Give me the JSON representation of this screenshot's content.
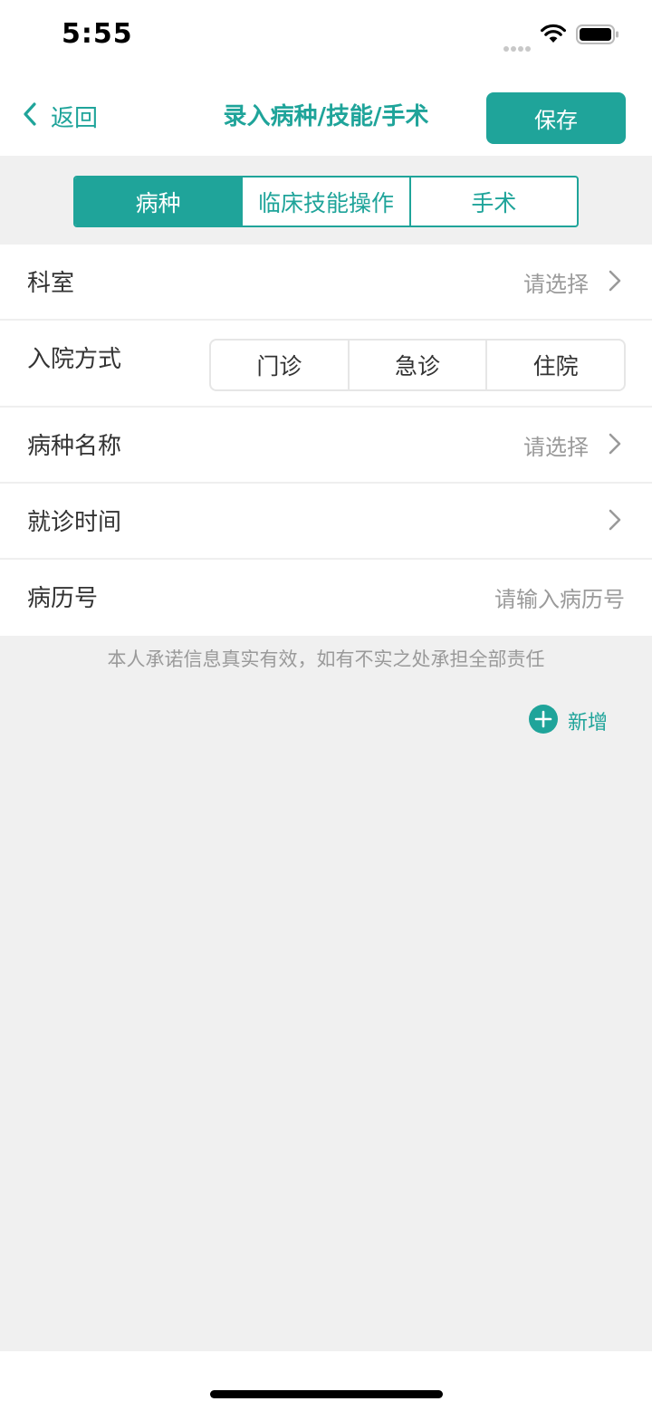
{
  "status": {
    "time": "5:55"
  },
  "nav": {
    "back_label": "返回",
    "title": "录入病种/技能/手术",
    "save_label": "保存"
  },
  "tabs": [
    {
      "label": "病种",
      "active": true
    },
    {
      "label": "临床技能操作",
      "active": false
    },
    {
      "label": "手术",
      "active": false
    }
  ],
  "form": {
    "department": {
      "label": "科室",
      "value": "请选择"
    },
    "admission": {
      "label": "入院方式",
      "options": [
        "门诊",
        "急诊",
        "住院"
      ]
    },
    "disease_name": {
      "label": "病种名称",
      "value": "请选择"
    },
    "visit_time": {
      "label": "就诊时间",
      "value": ""
    },
    "record_no": {
      "label": "病历号",
      "placeholder": "请输入病历号"
    }
  },
  "promise_text": "本人承诺信息真实有效，如有不实之处承担全部责任",
  "add_label": "新增",
  "colors": {
    "accent": "#1fa49a",
    "background": "#f0f0f0",
    "muted": "#9a9a9a"
  }
}
